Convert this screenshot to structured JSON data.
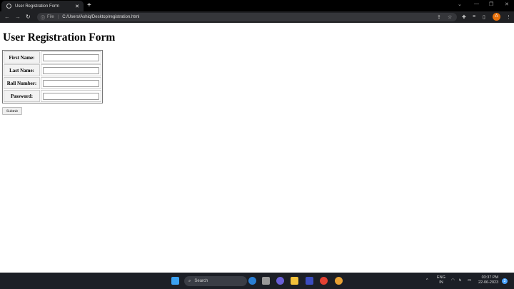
{
  "browser": {
    "tab_title": "User Registration Form",
    "address_scheme": "File",
    "address_url": "C:/Users/Ashiq/Desktop/registration.html",
    "profile_initial": "A"
  },
  "page": {
    "title": "User Registration Form",
    "fields": [
      {
        "label": "First Name:",
        "value": ""
      },
      {
        "label": "Last Name:",
        "value": ""
      },
      {
        "label": "Roll Number:",
        "value": ""
      },
      {
        "label": "Password:",
        "value": ""
      }
    ],
    "submit_label": "Submit"
  },
  "taskbar": {
    "search_placeholder": "Search",
    "lang_top": "ENG",
    "lang_bottom": "IN",
    "time": "03:37 PM",
    "date": "22-06-2023",
    "notification_count": "2"
  },
  "colors": {
    "accent": "#e8710a",
    "taskbar": "#1c1f26",
    "toolbar": "#202124"
  }
}
